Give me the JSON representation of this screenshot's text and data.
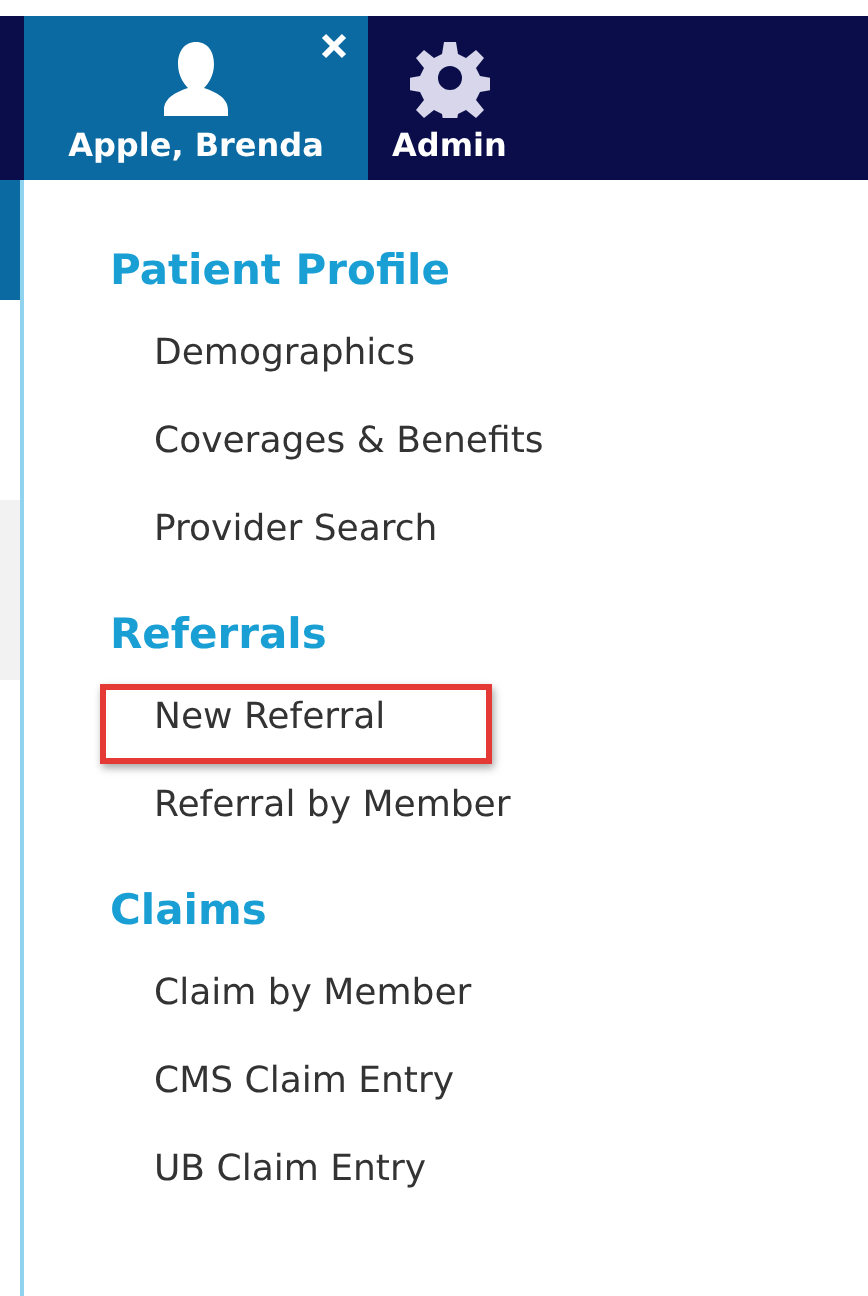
{
  "nav": {
    "tabs": [
      {
        "label": "Apple, Brenda",
        "kind": "user",
        "selected": true,
        "closable": true
      },
      {
        "label": "Admin",
        "kind": "admin",
        "selected": false,
        "closable": false
      }
    ]
  },
  "menu": {
    "sections": [
      {
        "title": "Patient Profile",
        "items": [
          {
            "label": "Demographics",
            "highlighted": false
          },
          {
            "label": "Coverages & Benefits",
            "highlighted": false
          },
          {
            "label": "Provider Search",
            "highlighted": false
          }
        ]
      },
      {
        "title": "Referrals",
        "items": [
          {
            "label": "New Referral",
            "highlighted": true
          },
          {
            "label": "Referral by Member",
            "highlighted": false
          }
        ]
      },
      {
        "title": "Claims",
        "items": [
          {
            "label": "Claim by Member",
            "highlighted": false
          },
          {
            "label": "CMS Claim Entry",
            "highlighted": false
          },
          {
            "label": "UB Claim Entry",
            "highlighted": false
          }
        ]
      }
    ]
  }
}
